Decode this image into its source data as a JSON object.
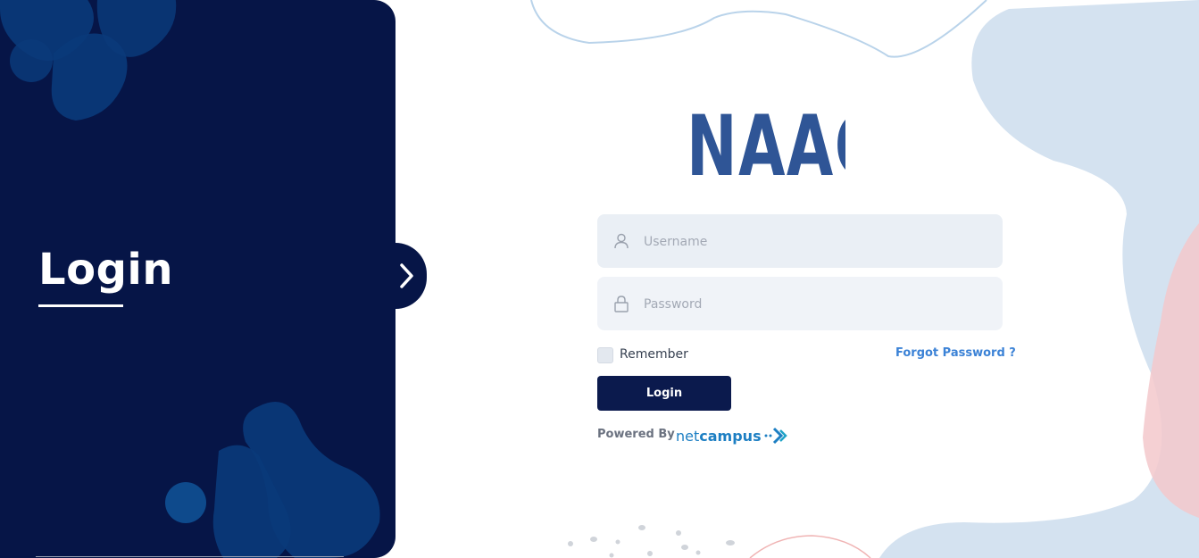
{
  "left_panel": {
    "title": "Login"
  },
  "logo": {
    "text": "NAAC"
  },
  "form": {
    "username_placeholder": "Username",
    "password_placeholder": "Password",
    "remember_label": "Remember",
    "forgot_label": "Forgot Password ?",
    "login_label": "Login"
  },
  "footer": {
    "powered_by": "Powered By",
    "brand_part1": "net",
    "brand_part2": "campus"
  },
  "colors": {
    "panel_bg": "#061547",
    "accent_blue": "#3b82d6",
    "logo_blue": "#2f5596",
    "button_bg": "#0b1a4d",
    "brand_blue": "#1d7fc3"
  },
  "icons": [
    "user-icon",
    "lock-icon",
    "chevron-right-icon",
    "brand-arrow-icon"
  ]
}
